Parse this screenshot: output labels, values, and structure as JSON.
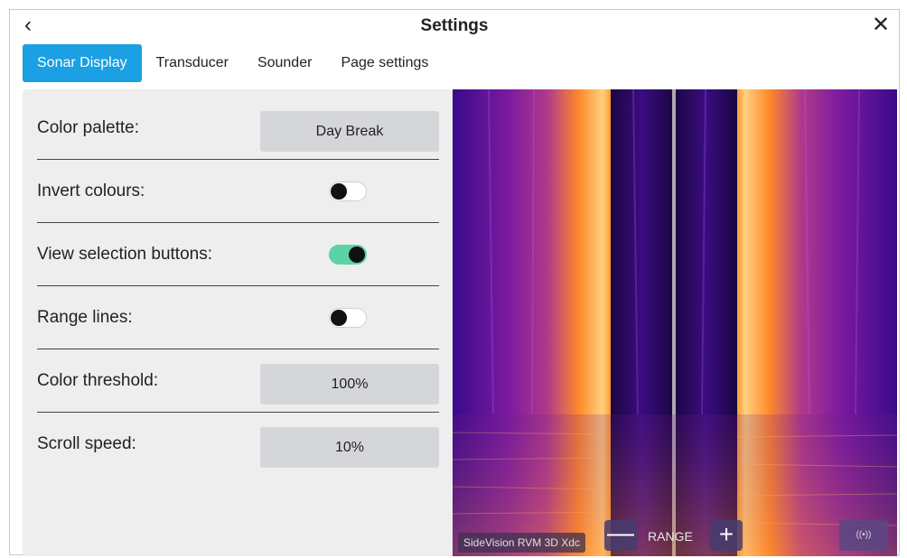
{
  "header": {
    "title": "Settings",
    "back_icon": "chevron-left-icon",
    "close_icon": "close-icon"
  },
  "tabs": [
    {
      "label": "Sonar Display",
      "active": true
    },
    {
      "label": "Transducer",
      "active": false
    },
    {
      "label": "Sounder",
      "active": false
    },
    {
      "label": "Page settings",
      "active": false
    }
  ],
  "settings": {
    "color_palette": {
      "label": "Color palette:",
      "value": "Day Break"
    },
    "invert_colours": {
      "label": "Invert colours:",
      "on": false
    },
    "view_selection_buttons": {
      "label": "View selection buttons:",
      "on": true
    },
    "range_lines": {
      "label": "Range lines:",
      "on": false
    },
    "color_threshold": {
      "label": "Color threshold:",
      "value": "100%"
    },
    "scroll_speed": {
      "label": "Scroll speed:",
      "value": "10%"
    }
  },
  "sonar": {
    "source_label": "SideVision RVM 3D Xdc",
    "range_label": "RANGE",
    "minus_label": "—",
    "plus_label": "+",
    "ping_label": "((•))"
  },
  "colors": {
    "accent": "#1aa0e3",
    "toggle_on": "#5bd3a7"
  }
}
